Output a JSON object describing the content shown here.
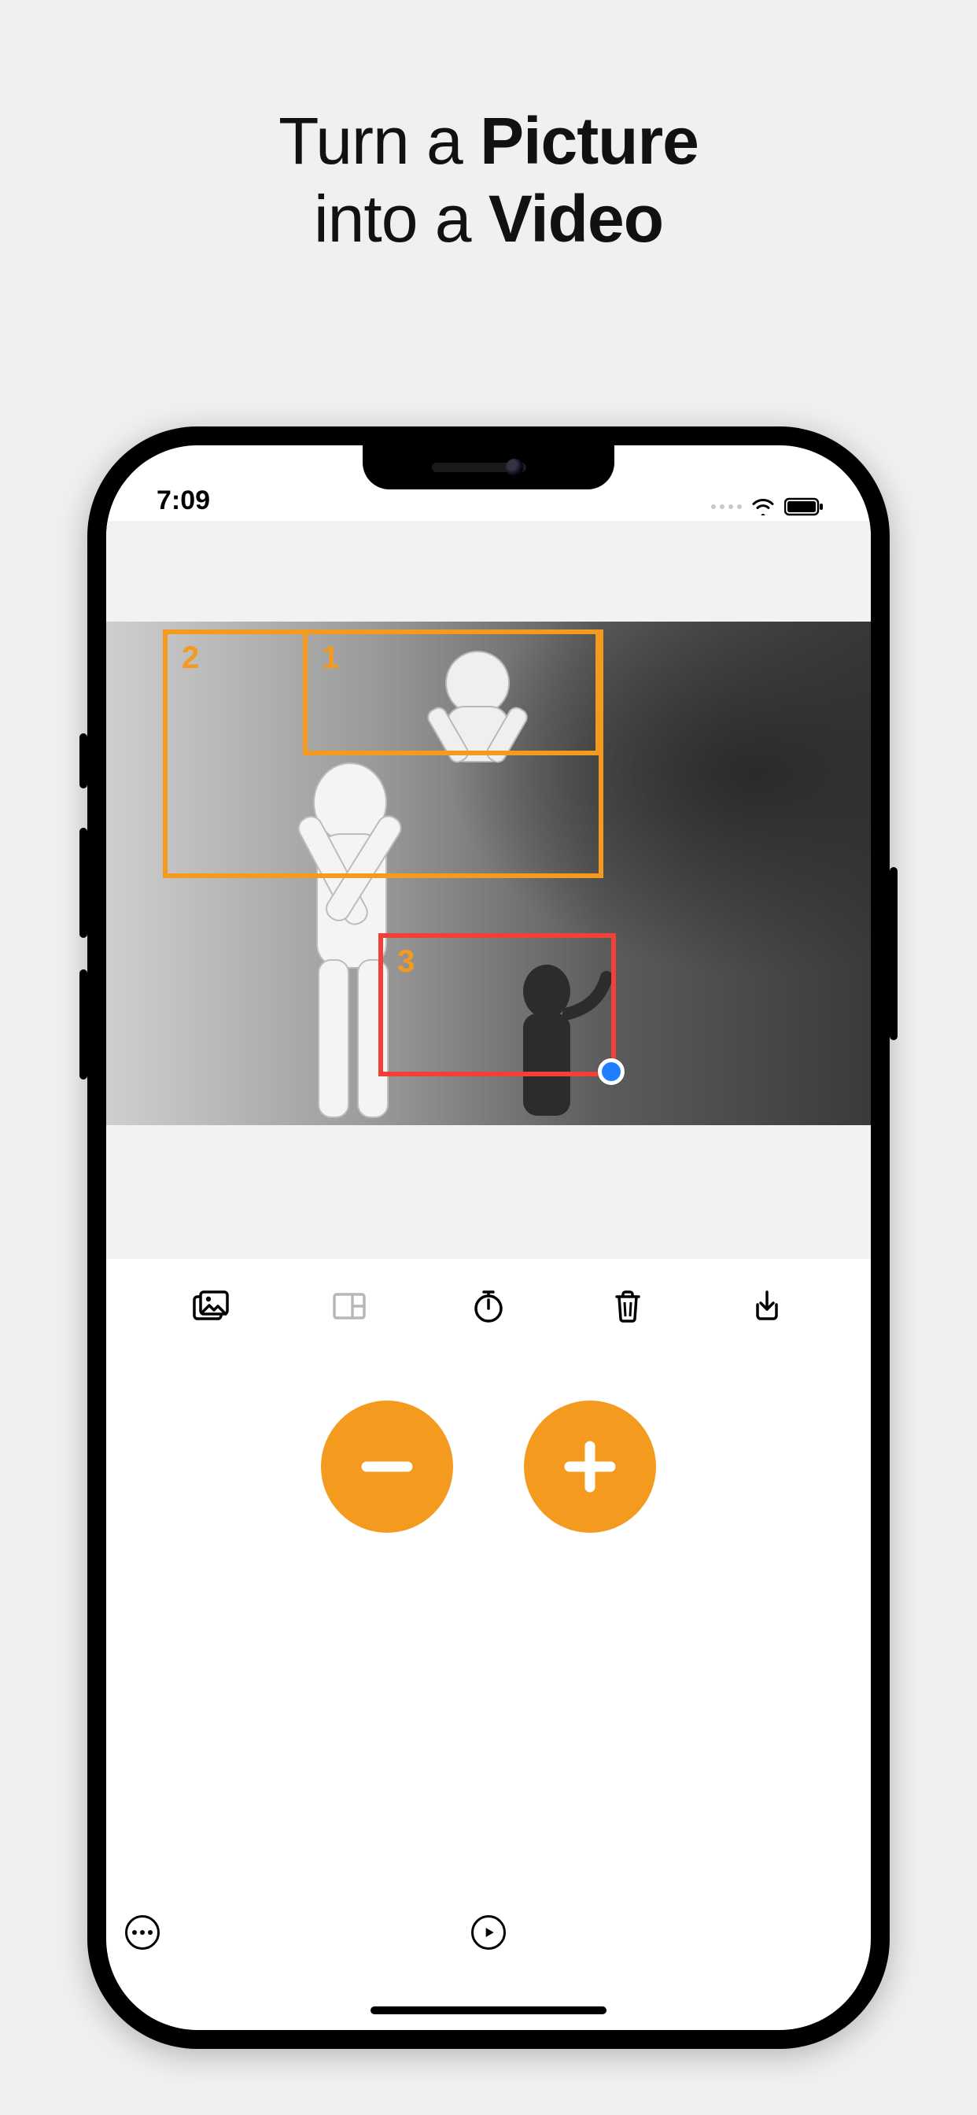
{
  "marketing": {
    "line1_a": "Turn a ",
    "line1_b": "Picture",
    "line2_a": "into a ",
    "line2_b": "Video"
  },
  "statusbar": {
    "time": "7:09"
  },
  "frames": [
    {
      "id": 1,
      "label": "1",
      "color": "orange",
      "selected": false
    },
    {
      "id": 2,
      "label": "2",
      "color": "orange",
      "selected": false
    },
    {
      "id": 3,
      "label": "3",
      "color": "red",
      "selected": true
    }
  ],
  "toolbar": {
    "items": [
      {
        "name": "photo-library-icon",
        "active": true
      },
      {
        "name": "layout-icon",
        "active": false
      },
      {
        "name": "timer-icon",
        "active": true
      },
      {
        "name": "trash-icon",
        "active": true
      },
      {
        "name": "export-icon",
        "active": true
      }
    ]
  },
  "controls": {
    "remove_label": "remove-frame",
    "add_label": "add-frame",
    "more_label": "more-options",
    "play_label": "play-preview"
  },
  "colors": {
    "accent": "#f39a1f",
    "danger": "#ef4135",
    "select": "#1d7fff"
  }
}
